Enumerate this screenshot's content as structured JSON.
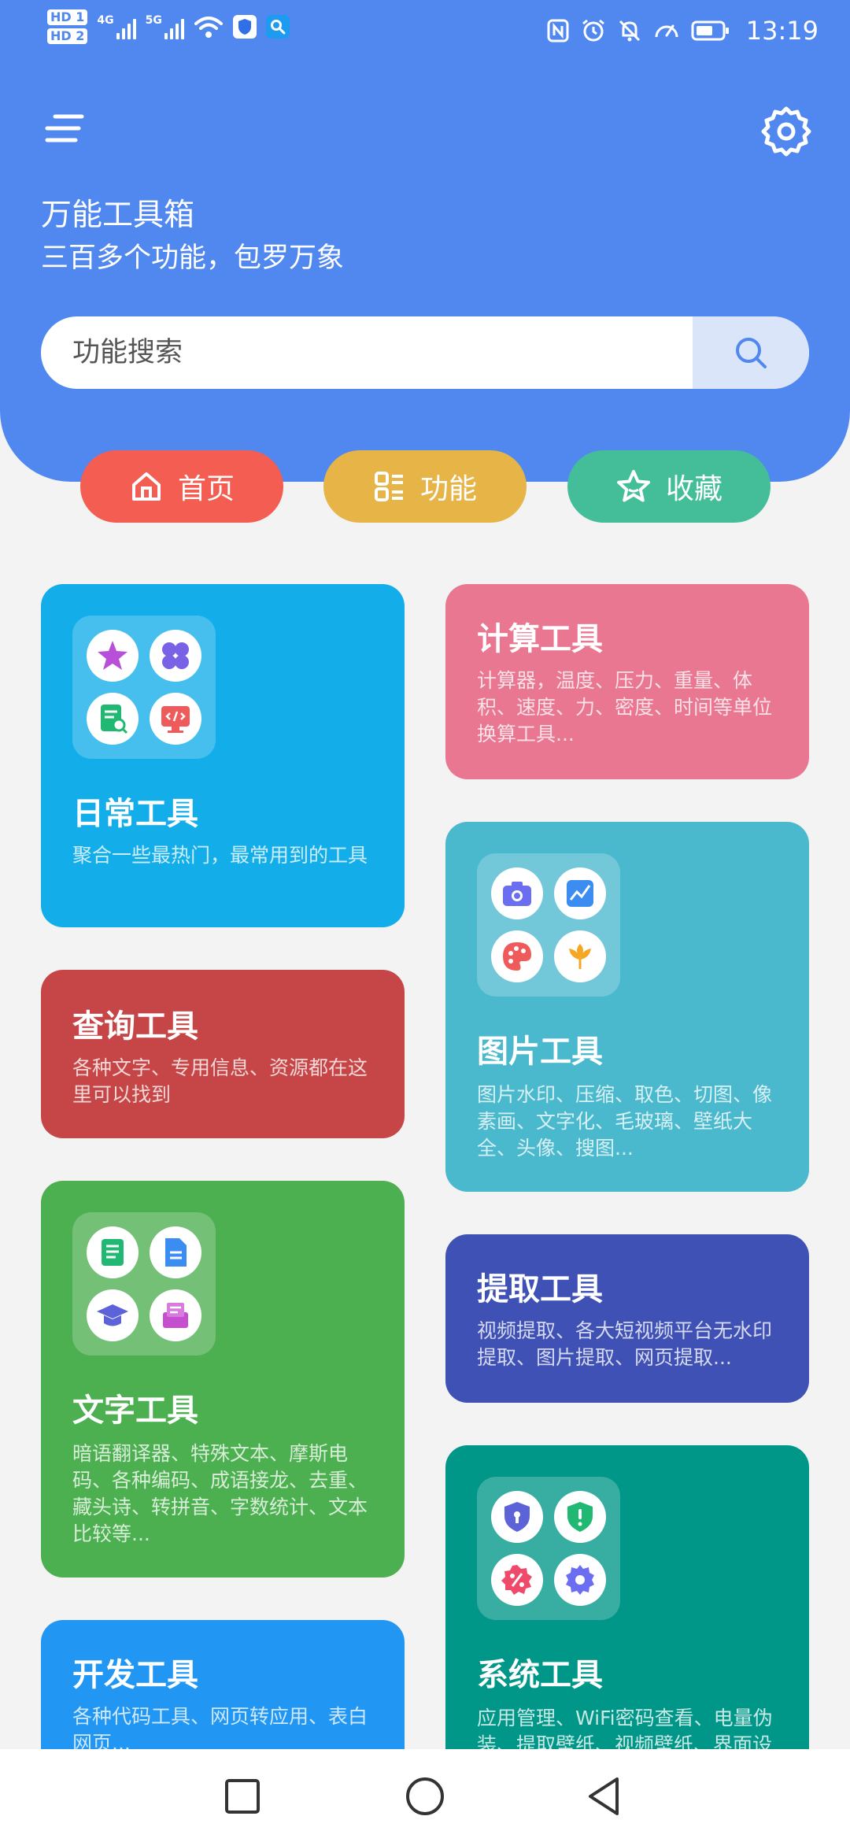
{
  "status": {
    "time": "13:19",
    "network_4g": "4G",
    "network_5g": "5G"
  },
  "header": {
    "title": "万能工具箱",
    "subtitle": "三百多个功能，包罗万象",
    "search_placeholder": "功能搜索"
  },
  "tabs": [
    {
      "label": "首页",
      "color": "#f35d52"
    },
    {
      "label": "功能",
      "color": "#e6b447"
    },
    {
      "label": "收藏",
      "color": "#43be98"
    }
  ],
  "cards": [
    {
      "title": "日常工具",
      "desc": "聚合一些最热门，最常用到的工具",
      "color": "#13aeea",
      "icons": [
        "star-icon",
        "clover-icon",
        "doc-search-icon",
        "code-screen-icon"
      ]
    },
    {
      "title": "计算工具",
      "desc": "计算器，温度、压力、重量、体积、速度、力、密度、时间等单位换算工具...",
      "color": "#e97791"
    },
    {
      "title": "查询工具",
      "desc": "各种文字、专用信息、资源都在这里可以找到",
      "color": "#c64647"
    },
    {
      "title": "图片工具",
      "desc": "图片水印、压缩、取色、切图、像素画、文字化、毛玻璃、壁纸大全、头像、搜图...",
      "color": "#4bb9cd",
      "icons": [
        "camera-icon",
        "photo-icon",
        "palette-icon",
        "flower-icon"
      ]
    },
    {
      "title": "文字工具",
      "desc": "暗语翻译器、特殊文本、摩斯电码、各种编码、成语接龙、去重、藏头诗、转拼音、字数统计、文本比较等...",
      "color": "#4caf50",
      "icons": [
        "document-icon",
        "file-icon",
        "graduation-cap-icon",
        "inbox-icon"
      ]
    },
    {
      "title": "提取工具",
      "desc": "视频提取、各大短视频平台无水印提取、图片提取、网页提取...",
      "color": "#3f51b5"
    },
    {
      "title": "开发工具",
      "desc": "各种代码工具、网页转应用、表白网页...",
      "color": "#2196f3"
    },
    {
      "title": "系统工具",
      "desc": "应用管理、WiFi密码查看、电量伪装、提取壁纸、视频壁纸、界面设置...",
      "color": "#009688",
      "icons": [
        "shield-lock-icon",
        "shield-alert-icon",
        "percent-badge-icon",
        "settings-icon"
      ]
    }
  ]
}
